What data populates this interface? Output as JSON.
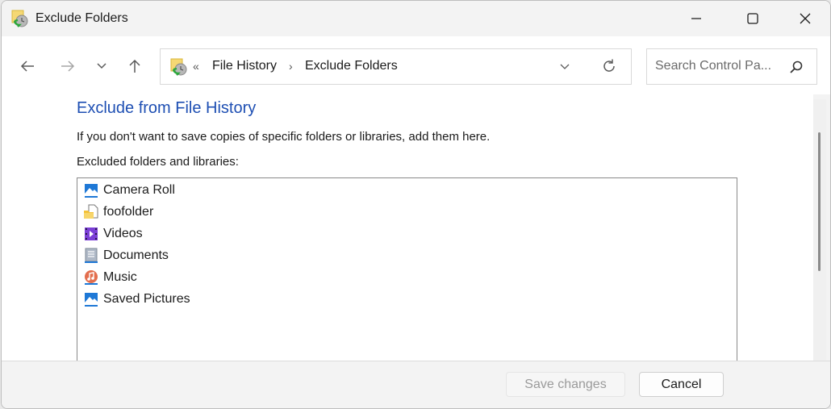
{
  "window": {
    "title": "Exclude Folders",
    "app_icon": "file-history-icon",
    "controls": {
      "minimize": "minimize-icon",
      "maximize": "maximize-icon",
      "close": "close-icon"
    }
  },
  "nav": {
    "back": "back-arrow-icon",
    "forward": "forward-arrow-icon",
    "recent": "chevron-down-icon",
    "up": "up-arrow-icon",
    "overflow": "«",
    "breadcrumbs": [
      {
        "label": "File History"
      },
      {
        "label": "Exclude Folders"
      }
    ],
    "separator": "›",
    "search_placeholder": "Search Control Pa..."
  },
  "content": {
    "heading": "Exclude from File History",
    "description": "If you don't want to save copies of specific folders or libraries, add them here.",
    "list_label": "Excluded folders and libraries:",
    "items": [
      {
        "label": "Camera Roll",
        "icon": "pictures-library-icon"
      },
      {
        "label": "foofolder",
        "icon": "folder-icon"
      },
      {
        "label": "Videos",
        "icon": "videos-library-icon"
      },
      {
        "label": "Documents",
        "icon": "documents-library-icon"
      },
      {
        "label": "Music",
        "icon": "music-library-icon"
      },
      {
        "label": "Saved Pictures",
        "icon": "pictures-library-icon"
      }
    ]
  },
  "footer": {
    "save_label": "Save changes",
    "save_enabled": false,
    "cancel_label": "Cancel"
  },
  "colors": {
    "heading": "#1e4fb3",
    "window_bg": "#f3f3f3",
    "content_bg": "#ffffff"
  }
}
